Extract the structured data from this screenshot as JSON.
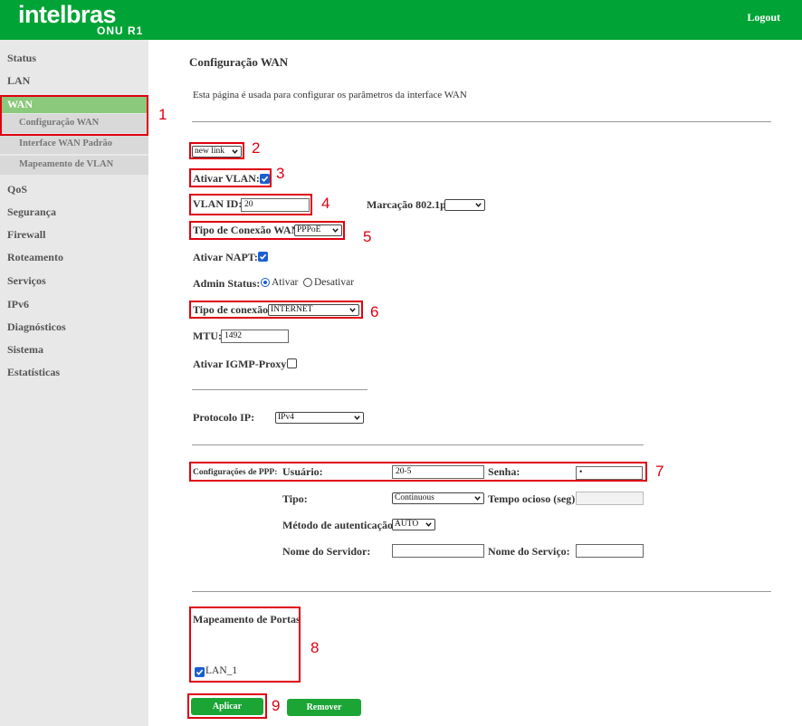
{
  "header": {
    "brand": "intelbras",
    "model": "ONU R1",
    "logout": "Logout",
    "bg_color": "#00a335"
  },
  "sidebar": {
    "items": [
      "Status",
      "LAN",
      "WAN",
      "QoS",
      "Segurança",
      "Firewall",
      "Roteamento",
      "Serviços",
      "IPv6",
      "Diagnósticos",
      "Sistema",
      "Estatísticas"
    ],
    "wan_sub": [
      "Configuração WAN",
      "Interface WAN Padrão",
      "Mapeamento de VLAN"
    ],
    "active": "WAN",
    "active_sub": "Configuração WAN"
  },
  "page": {
    "title": "Configuração WAN",
    "description": "Esta página é usada para configurar os parâmetros da interface WAN"
  },
  "form": {
    "link_select": "new link",
    "vlan_enable_label": "Ativar VLAN:",
    "vlan_enable_checked": true,
    "vlan_id_label": "VLAN ID:",
    "vlan_id": "20",
    "marcacao_label": "Marcação 802.1p",
    "marcacao_value": "",
    "conn_type_label": "Tipo de Conexão WAN:",
    "conn_type_value": "PPPoE",
    "napt_label": "Ativar NAPT:",
    "napt_checked": true,
    "admin_status_label": "Admin Status:",
    "admin_ativar": "Ativar",
    "admin_desativar": "Desativar",
    "admin_selected": "Ativar",
    "tipo_conexao_label": "Tipo de conexão:",
    "tipo_conexao_value": "INTERNET",
    "mtu_label": "MTU:",
    "mtu_value": "1492",
    "igmp_label": "Ativar IGMP-Proxy:",
    "igmp_checked": false,
    "protocolo_label": "Protocolo IP:",
    "protocolo_value": "IPv4"
  },
  "ppp": {
    "section_label": "Configurações de PPP:",
    "usuario_label": "Usuário:",
    "usuario_value": "20-5",
    "senha_label": "Senha:",
    "senha_value": "•",
    "tipo_label": "Tipo:",
    "tipo_value": "Continuous",
    "tempo_label": "Tempo ocioso (seg):",
    "tempo_value": "",
    "auth_label": "Método de autenticação:",
    "auth_value": "AUTO",
    "servidor_label": "Nome do Servidor:",
    "servidor_value": "",
    "servico_label": "Nome do Serviço:",
    "servico_value": ""
  },
  "port_mapping": {
    "title": "Mapeamento de Portas",
    "lan1_label": "LAN_1",
    "lan1_checked": true
  },
  "buttons": {
    "apply": "Aplicar",
    "remove": "Remover"
  },
  "annotations": {
    "labels": [
      "1",
      "2",
      "3",
      "4",
      "5",
      "6",
      "7",
      "8",
      "9"
    ],
    "color": "#e00010"
  }
}
